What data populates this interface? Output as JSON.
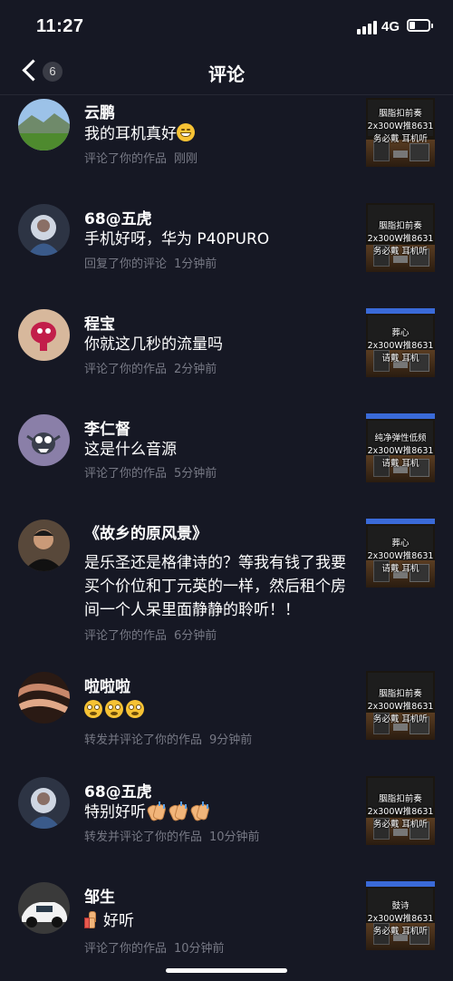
{
  "status": {
    "time": "11:27",
    "network": "4G"
  },
  "nav": {
    "back_count": "6",
    "title": "评论"
  },
  "items": [
    {
      "username": "云鹏",
      "comment": "我的耳机真好",
      "action": "评论了你的作品",
      "time": "刚刚",
      "thumb": [
        "胭脂扣前奏",
        "2x300W推8631",
        "务必戴  耳机听"
      ]
    },
    {
      "username": "68@五虎",
      "comment": "手机好呀，华为 P40PURO",
      "action": "回复了你的评论",
      "time": "1分钟前",
      "thumb": [
        "胭脂扣前奏",
        "2x300W推8631",
        "务必戴  耳机听"
      ]
    },
    {
      "username": "程宝",
      "comment": "你就这几秒的流量吗",
      "action": "评论了你的作品",
      "time": "2分钟前",
      "thumb": [
        "葬心",
        "2x300W推8631",
        "请戴  耳机"
      ]
    },
    {
      "username": "李仁督",
      "comment": "这是什么音源",
      "action": "评论了你的作品",
      "time": "5分钟前",
      "thumb": [
        "纯净弹性低频",
        "2x300W推8631",
        "请戴  耳机"
      ]
    },
    {
      "username": "《故乡的原风景》",
      "comment": "是乐圣还是格律诗的？等我有钱了我要买个价位和丁元英的一样，然后租个房间一个人呆里面静静的聆听！！",
      "action": "评论了你的作品",
      "time": "6分钟前",
      "thumb": [
        "葬心",
        "2x300W推8631",
        "请戴  耳机"
      ]
    },
    {
      "username": "啦啦啦",
      "comment": "",
      "action": "转发并评论了你的作品",
      "time": "9分钟前",
      "thumb": [
        "胭脂扣前奏",
        "2x300W推8631",
        "务必戴  耳机听"
      ]
    },
    {
      "username": "68@五虎",
      "comment": "特别好听",
      "action": "转发并评论了你的作品",
      "time": "10分钟前",
      "thumb": [
        "胭脂扣前奏",
        "2x300W推8631",
        "务必戴  耳机听"
      ]
    },
    {
      "username": "邹生",
      "comment": "好听",
      "action": "评论了你的作品",
      "time": "10分钟前",
      "thumb": [
        "鼓诗",
        "2x300W推8631",
        "务必戴  耳机听"
      ]
    }
  ]
}
